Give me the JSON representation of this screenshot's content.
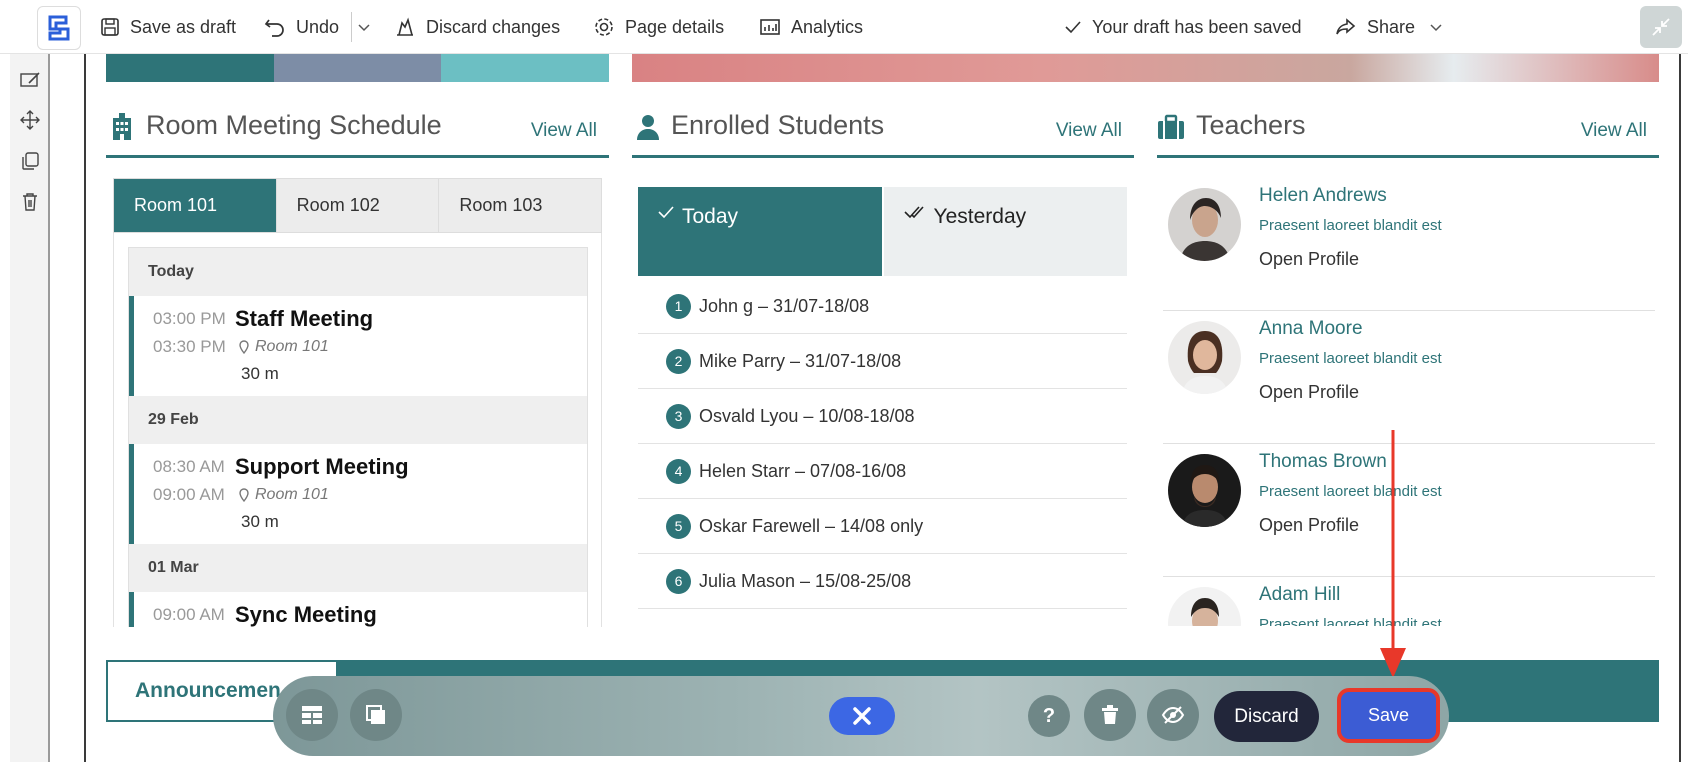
{
  "toolbar": {
    "save_draft": "Save as draft",
    "undo": "Undo",
    "discard_changes": "Discard changes",
    "page_details": "Page details",
    "analytics": "Analytics",
    "status": "Your draft has been saved",
    "share": "Share"
  },
  "room_schedule": {
    "title": "Room Meeting Schedule",
    "view_all": "View All",
    "tabs": [
      "Room 101",
      "Room 102",
      "Room 103"
    ],
    "groups": [
      {
        "day": "Today",
        "start": "03:00 PM",
        "end": "03:30 PM",
        "title": "Staff Meeting",
        "room": "Room 101",
        "duration": "30 m"
      },
      {
        "day": "29 Feb",
        "start": "08:30 AM",
        "end": "09:00 AM",
        "title": "Support Meeting",
        "room": "Room 101",
        "duration": "30 m"
      },
      {
        "day": "01 Mar",
        "start": "09:00 AM",
        "end": "",
        "title": "Sync Meeting",
        "room": "",
        "duration": ""
      }
    ]
  },
  "enrolled": {
    "title": "Enrolled Students",
    "view_all": "View All",
    "tabs": [
      "Today",
      "Yesterday"
    ],
    "students": [
      {
        "n": "1",
        "text": "John g – 31/07-18/08"
      },
      {
        "n": "2",
        "text": "Mike Parry – 31/07-18/08"
      },
      {
        "n": "3",
        "text": "Osvald Lyou – 10/08-18/08"
      },
      {
        "n": "4",
        "text": "Helen Starr – 07/08-16/08"
      },
      {
        "n": "5",
        "text": "Oskar Farewell – 14/08 only"
      },
      {
        "n": "6",
        "text": "Julia Mason – 15/08-25/08"
      }
    ]
  },
  "teachers": {
    "title": "Teachers",
    "view_all": "View All",
    "list": [
      {
        "name": "Helen Andrews",
        "sub": "Praesent laoreet blandit est",
        "link": "Open Profile"
      },
      {
        "name": "Anna Moore",
        "sub": "Praesent laoreet blandit est",
        "link": "Open Profile"
      },
      {
        "name": "Thomas Brown",
        "sub": "Praesent laoreet blandit est",
        "link": "Open Profile"
      },
      {
        "name": "Adam Hill",
        "sub": "Praesent laoreet blandit est",
        "link": ""
      }
    ]
  },
  "announcements": {
    "label": "Announcemen"
  },
  "edit_bar": {
    "discard": "Discard",
    "save": "Save",
    "help": "?"
  },
  "colors": {
    "accent": "#2e7478",
    "primary_blue": "#3c5cd4",
    "highlight_red": "#e8382a"
  }
}
